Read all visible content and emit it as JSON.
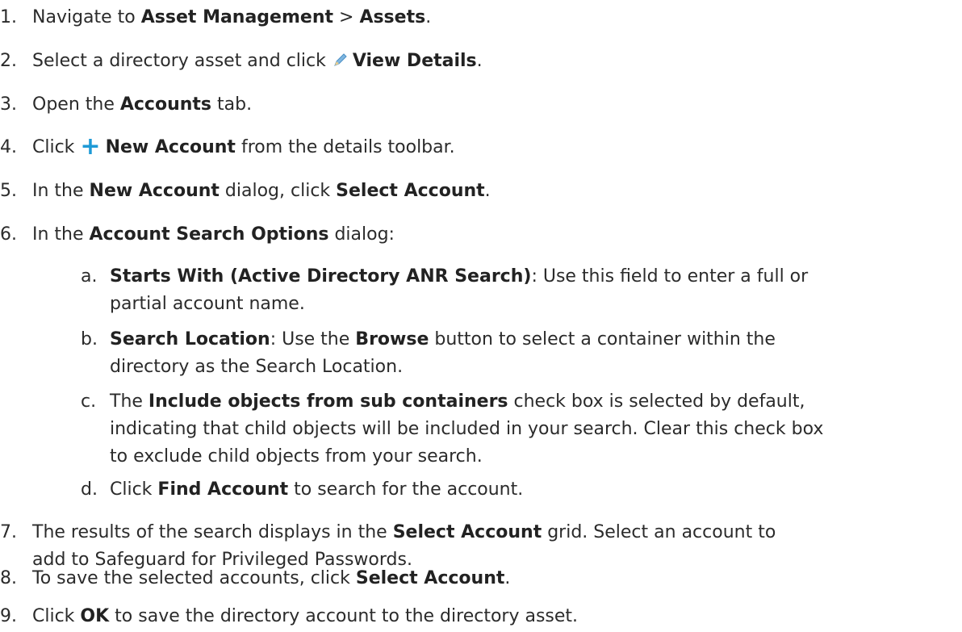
{
  "steps": [
    {
      "num": "1.",
      "parts": [
        "Navigate to ",
        "Asset Management",
        " > ",
        "Assets",
        "."
      ]
    },
    {
      "num": "2.",
      "parts": [
        "Select a directory asset and click ",
        "View Details",
        "."
      ],
      "icon": "pencil-icon"
    },
    {
      "num": "3.",
      "parts": [
        "Open the ",
        "Accounts",
        " tab."
      ]
    },
    {
      "num": "4.",
      "parts": [
        "Click ",
        "New Account",
        " from the details toolbar."
      ],
      "icon": "plus-icon"
    },
    {
      "num": "5.",
      "parts": [
        "In the ",
        "New Account",
        " dialog, click ",
        "Select Account",
        "."
      ]
    },
    {
      "num": "6.",
      "parts": [
        "In the ",
        "Account Search Options",
        " dialog:"
      ]
    },
    {
      "num": "7.",
      "line1": [
        "The results of the search displays in the ",
        "Select Account",
        " grid. Select an account to"
      ],
      "line2": "add to Safeguard for Privileged Passwords."
    },
    {
      "num": "8.",
      "parts": [
        "To save the selected accounts, click ",
        "Select Account",
        "."
      ]
    },
    {
      "num": "9.",
      "parts": [
        "Click ",
        "OK",
        " to save the directory account to the directory asset."
      ]
    }
  ],
  "substeps": [
    {
      "num": "a.",
      "line1": [
        "Starts With (Active Directory ANR Search)",
        ": Use this field to enter a full or"
      ],
      "line2": "partial account name."
    },
    {
      "num": "b.",
      "line1": [
        "Search Location",
        ": Use the ",
        "Browse",
        " button to select a container within the"
      ],
      "line2": "directory as the Search Location."
    },
    {
      "num": "c.",
      "line1": [
        "The ",
        "Include objects from sub containers",
        " check box is selected by default,"
      ],
      "line2": "indicating that child objects will be included in your search. Clear this check box",
      "line3": "to exclude child objects from your search."
    },
    {
      "num": "d.",
      "parts": [
        "Click ",
        "Find Account",
        " to search for the account."
      ]
    }
  ],
  "icons": {
    "plus_glyph": "+",
    "plus_color": "#1e9ad6"
  }
}
